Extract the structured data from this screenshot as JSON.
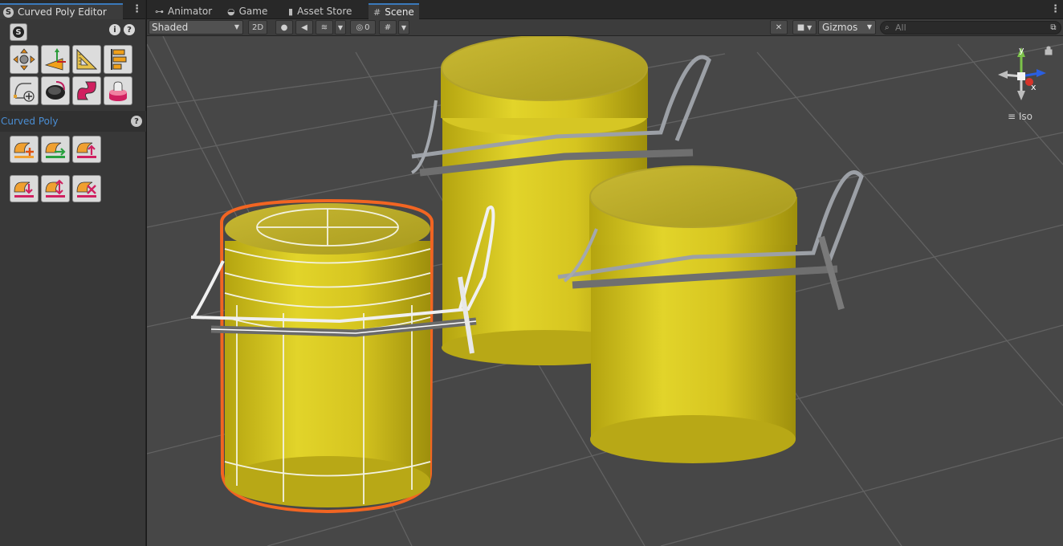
{
  "left_panel": {
    "tab_title": "Curved Poly Editor",
    "section_title": "Curved Poly",
    "tool_icons": [
      "move-points-tool-icon",
      "extrude-tool-icon",
      "ruler-tool-icon",
      "align-tool-icon",
      "add-curve-tool-icon",
      "paint-tool-icon",
      "curve-shape-tool-icon",
      "stack-tool-icon"
    ],
    "row1_icons": [
      "add-curve-icon",
      "forward-curve-icon",
      "raise-curve-icon"
    ],
    "row2_icons": [
      "lower-curve-icon",
      "split-curve-icon",
      "delete-curve-icon"
    ]
  },
  "tabs": [
    {
      "label": "Animator",
      "icon": "animator-icon"
    },
    {
      "label": "Game",
      "icon": "gamepad-icon"
    },
    {
      "label": "Asset Store",
      "icon": "store-bag-icon"
    },
    {
      "label": "Scene",
      "icon": "grid-hash-icon",
      "active": true
    }
  ],
  "toolbar": {
    "shading_mode": "Shaded",
    "mode_2d": "2D",
    "hidden_count": "0",
    "gizmos_label": "Gizmos",
    "search_placeholder": "All"
  },
  "gizmo": {
    "axis_y": "y",
    "axis_x": "x",
    "projection_label": "Iso"
  },
  "colors": {
    "accent": "#3a79bb",
    "selection_outline": "#f26522",
    "jar_yellow": "#d4c21a",
    "background": "#474747"
  }
}
